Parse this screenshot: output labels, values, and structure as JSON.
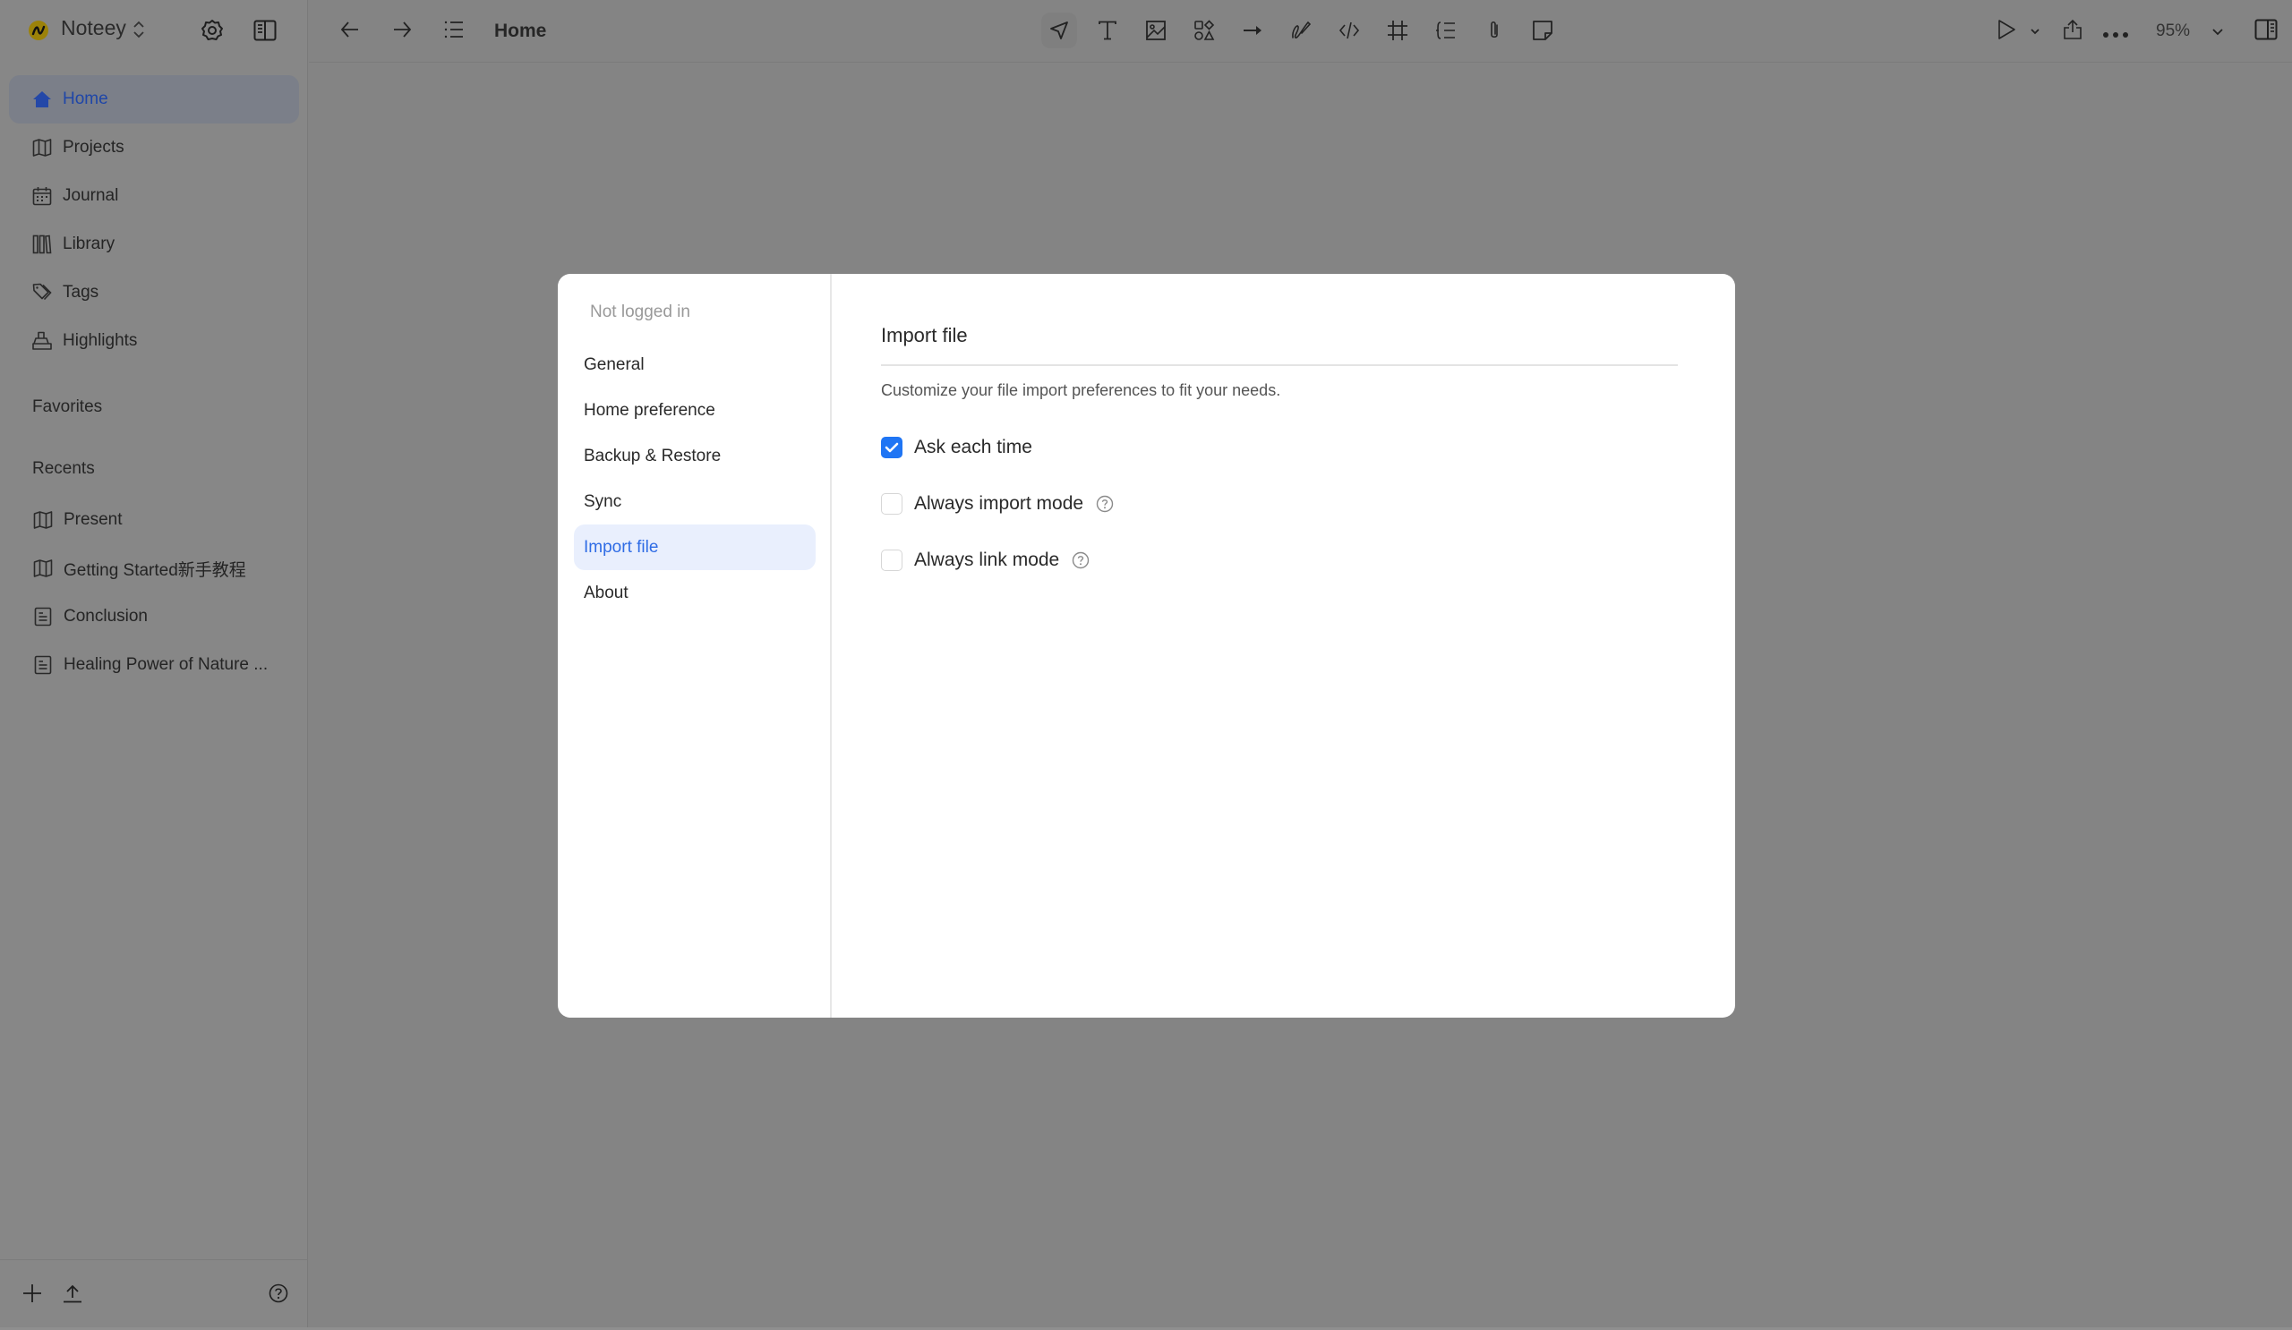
{
  "sidebar": {
    "workspace_name": "Noteey",
    "nav": [
      {
        "label": "Home",
        "icon": "home-icon",
        "active": true
      },
      {
        "label": "Projects",
        "icon": "map-icon"
      },
      {
        "label": "Journal",
        "icon": "calendar-icon"
      },
      {
        "label": "Library",
        "icon": "library-icon"
      },
      {
        "label": "Tags",
        "icon": "tag-icon"
      },
      {
        "label": "Highlights",
        "icon": "highlighter-icon"
      }
    ],
    "favorites_label": "Favorites",
    "recents_label": "Recents",
    "recents": [
      {
        "label": "Present",
        "icon": "map-icon"
      },
      {
        "label": "Getting Started新手教程",
        "icon": "map-icon"
      },
      {
        "label": "Conclusion",
        "icon": "document-icon"
      },
      {
        "label": "Healing Power of Nature ...",
        "icon": "document-icon"
      }
    ]
  },
  "topbar": {
    "title": "Home",
    "zoom": "95%"
  },
  "settings_modal": {
    "user_status": "Not logged in",
    "nav": [
      {
        "label": "General"
      },
      {
        "label": "Home preference"
      },
      {
        "label": "Backup & Restore"
      },
      {
        "label": "Sync"
      },
      {
        "label": "Import file",
        "active": true
      },
      {
        "label": "About"
      }
    ],
    "section_title": "Import file",
    "description": "Customize your file import preferences to fit your needs.",
    "options": [
      {
        "label": "Ask each time",
        "checked": true,
        "has_help": false
      },
      {
        "label": "Always import mode",
        "checked": false,
        "has_help": true
      },
      {
        "label": "Always link mode",
        "checked": false,
        "has_help": true
      }
    ]
  },
  "colors": {
    "accent": "#1f75f4",
    "active_nav_text": "#2f6ce5",
    "active_nav_bg": "#e9effd"
  }
}
